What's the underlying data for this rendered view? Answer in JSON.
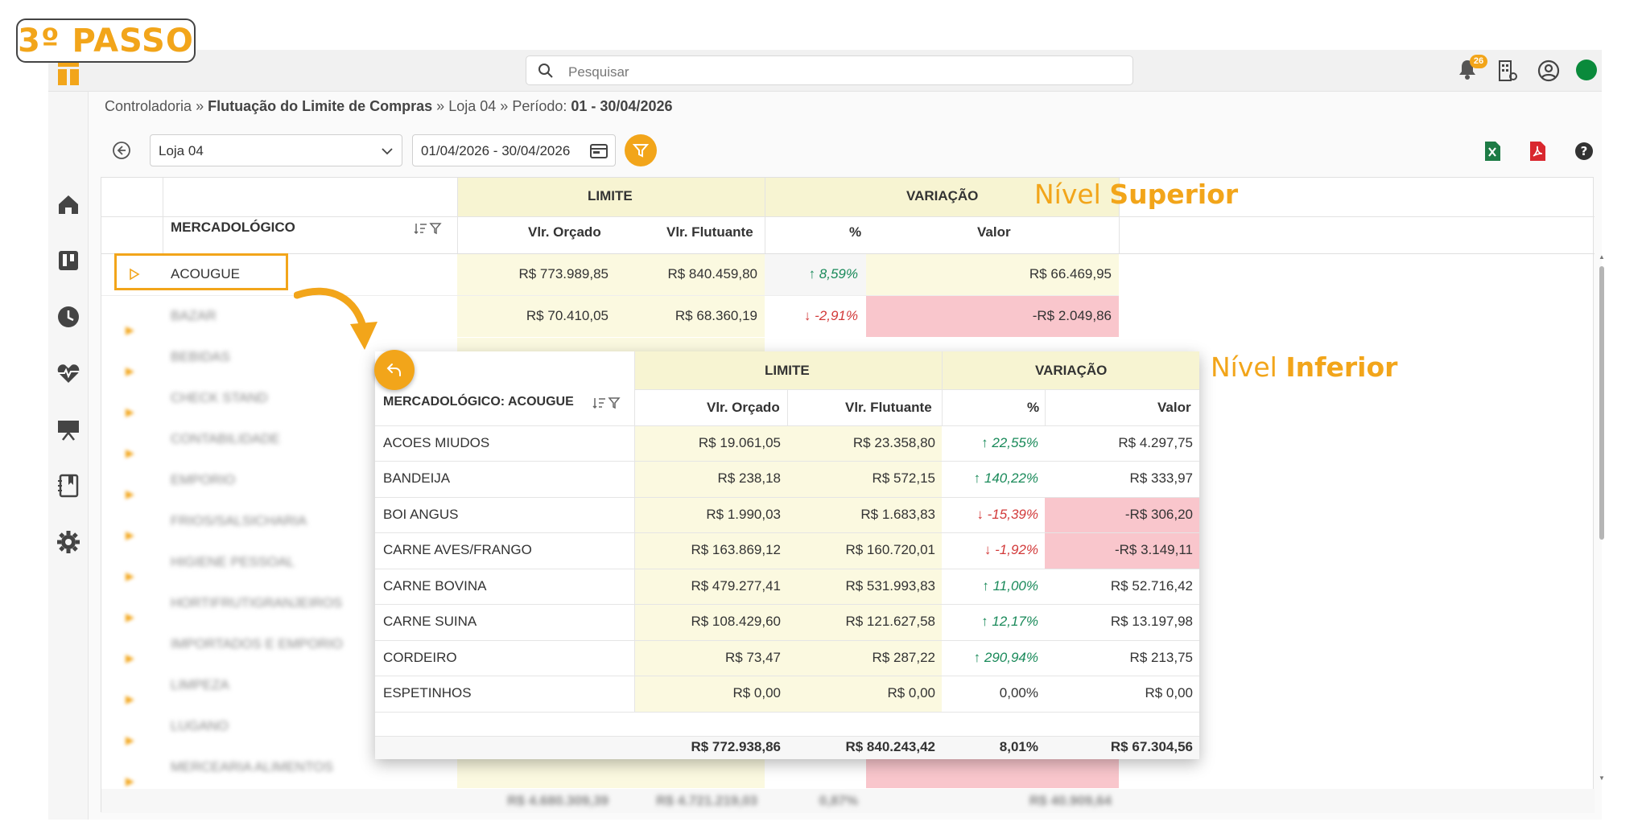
{
  "step_badge": "3º PASSO",
  "search": {
    "placeholder": "Pesquisar"
  },
  "notifications": {
    "count": "26"
  },
  "breadcrumb": {
    "part1": "Controladoria",
    "sep": "»",
    "page": "Flutuação do Limite de Compras",
    "store": "Loja 04",
    "period_label": "Período:",
    "period": "01 - 30/04/2026"
  },
  "toolbar": {
    "store_select": "Loja 04",
    "date_range": "01/04/2026 - 30/04/2026"
  },
  "colors": {
    "accent": "#f2a51a",
    "up": "#1a8a5a",
    "down": "#d23a3a",
    "negative_bg": "#f9c6cc",
    "limit_bg": "#fbf9e0",
    "status": "#0a8a3b"
  },
  "icons": [
    "search-icon",
    "bell-icon",
    "building-icon",
    "user-circle-icon",
    "status-dot",
    "home-icon",
    "board-icon",
    "clock-icon",
    "heart-pulse-icon",
    "presentation-icon",
    "book-icon",
    "gear-icon",
    "back-icon",
    "chevron-down-icon",
    "calendar-icon",
    "filter-icon",
    "excel-icon",
    "pdf-icon",
    "help-icon",
    "sort-icon",
    "expand-arrow-icon",
    "return-icon"
  ],
  "level_top": {
    "prefix": "Nível",
    "strong": "Superior"
  },
  "level_bottom": {
    "prefix": "Nível",
    "strong": "Inferior"
  },
  "main_table": {
    "group_limit": "LIMITE",
    "group_variation": "VARIAÇÃO",
    "col_category": "MERCADOLÓGICO",
    "col_budget": "Vlr. Orçado",
    "col_floating": "Vlr. Flutuante",
    "col_pct": "%",
    "col_value": "Valor",
    "rows": [
      {
        "name": "ACOUGUE",
        "budget": "R$ 773.989,85",
        "floating": "R$ 840.459,80",
        "pct": "8,59%",
        "dir": "up",
        "value": "R$ 66.469,95"
      },
      {
        "name": "BAZAR",
        "budget": "R$ 70.410,05",
        "floating": "R$ 68.360,19",
        "pct": "-2,91%",
        "dir": "down",
        "value": "-R$ 2.049,86"
      },
      {
        "name": "BEBIDAS"
      },
      {
        "name": "CHECK STAND"
      },
      {
        "name": "CONTABILIDADE"
      },
      {
        "name": "EMPORIO"
      },
      {
        "name": "FRIOS/SALSICHARIA"
      },
      {
        "name": "HIGIENE PESSOAL"
      },
      {
        "name": "HORTIFRUTIGRANJEIROS"
      },
      {
        "name": "IMPORTADOS E EMPORIO"
      },
      {
        "name": "LIMPEZA"
      },
      {
        "name": "LUGANO"
      },
      {
        "name": "MERCEARIA ALIMENTOS"
      }
    ],
    "totals": {
      "budget": "R$ 4.680.309,39",
      "floating": "R$ 4.721.219,03",
      "pct": "0,87%",
      "value": "R$ 40.909,64"
    }
  },
  "sub_table": {
    "title": "MERCADOLÓGICO: ACOUGUE",
    "group_limit": "LIMITE",
    "group_variation": "VARIAÇÃO",
    "col_budget": "Vlr. Orçado",
    "col_floating": "Vlr. Flutuante",
    "col_pct": "%",
    "col_value": "Valor",
    "rows": [
      {
        "name": "ACOES MIUDOS",
        "budget": "R$ 19.061,05",
        "floating": "R$ 23.358,80",
        "pct": "22,55%",
        "dir": "up",
        "value": "R$ 4.297,75"
      },
      {
        "name": "BANDEIJA",
        "budget": "R$ 238,18",
        "floating": "R$ 572,15",
        "pct": "140,22%",
        "dir": "up",
        "value": "R$ 333,97"
      },
      {
        "name": "BOI ANGUS",
        "budget": "R$ 1.990,03",
        "floating": "R$ 1.683,83",
        "pct": "-15,39%",
        "dir": "down",
        "value": "-R$ 306,20"
      },
      {
        "name": "CARNE AVES/FRANGO",
        "budget": "R$ 163.869,12",
        "floating": "R$ 160.720,01",
        "pct": "-1,92%",
        "dir": "down",
        "value": "-R$ 3.149,11"
      },
      {
        "name": "CARNE BOVINA",
        "budget": "R$ 479.277,41",
        "floating": "R$ 531.993,83",
        "pct": "11,00%",
        "dir": "up",
        "value": "R$ 52.716,42"
      },
      {
        "name": "CARNE SUINA",
        "budget": "R$ 108.429,60",
        "floating": "R$ 121.627,58",
        "pct": "12,17%",
        "dir": "up",
        "value": "R$ 13.197,98"
      },
      {
        "name": "CORDEIRO",
        "budget": "R$ 73,47",
        "floating": "R$ 287,22",
        "pct": "290,94%",
        "dir": "up",
        "value": "R$ 213,75"
      },
      {
        "name": "ESPETINHOS",
        "budget": "R$ 0,00",
        "floating": "R$ 0,00",
        "pct": "0,00%",
        "dir": "none",
        "value": "R$ 0,00"
      }
    ],
    "totals": {
      "budget": "R$ 772.938,86",
      "floating": "R$ 840.243,42",
      "pct": "8,01%",
      "value": "R$ 67.304,56"
    }
  }
}
